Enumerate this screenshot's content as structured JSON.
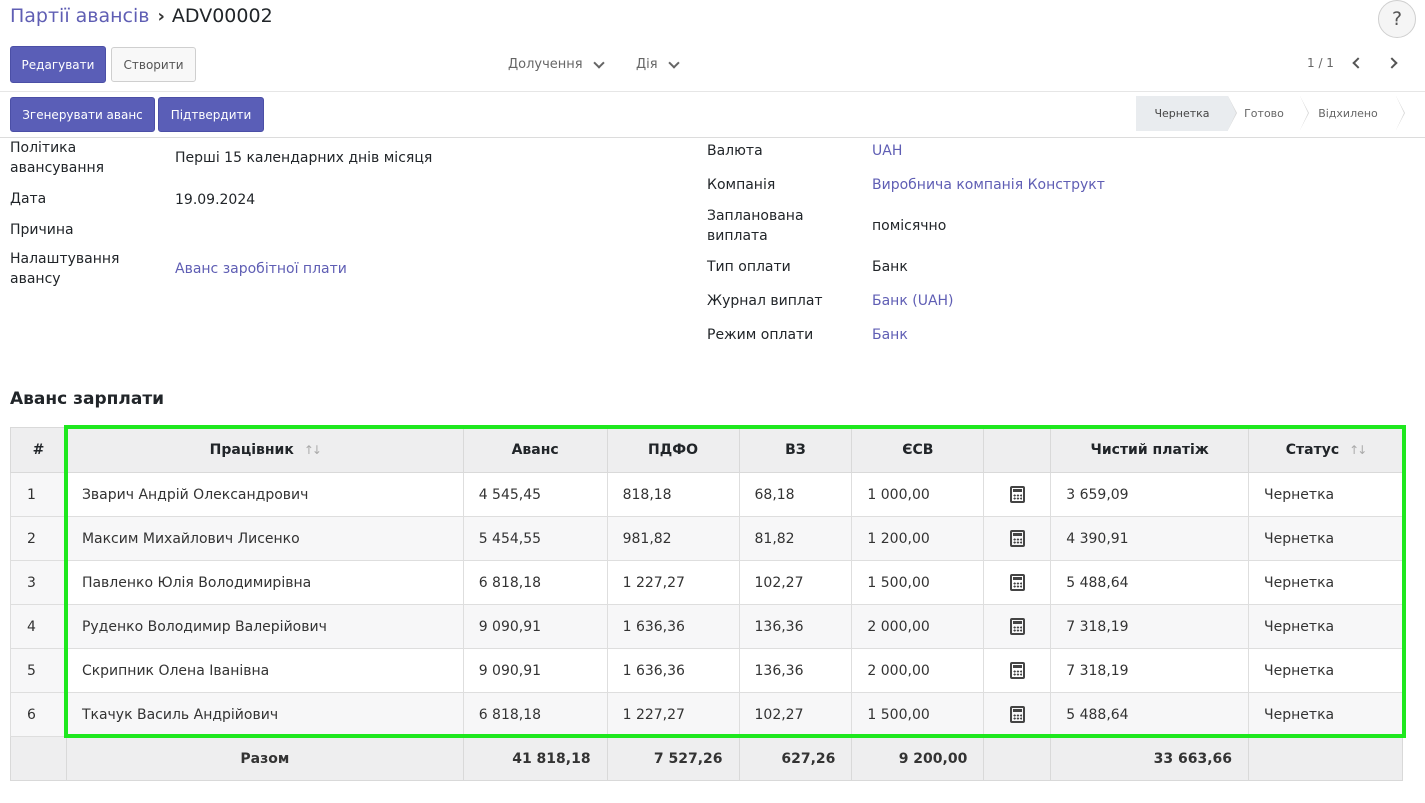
{
  "breadcrumb": {
    "parent": "Партії авансів",
    "separator": "›",
    "current": "ADV00002"
  },
  "help": {
    "label": "?"
  },
  "toolbar": {
    "edit": "Редагувати",
    "create": "Створити",
    "attach": "Долучення",
    "action": "Дія",
    "pager": "1 / 1"
  },
  "actions": {
    "generate": "Згенерувати аванс",
    "confirm": "Підтвердити"
  },
  "stages": [
    "Чернетка",
    "Готово",
    "Відхилено"
  ],
  "form_left": [
    {
      "label": "Політика авансування",
      "value": "Перші 15 календарних днів місяця",
      "link": false
    },
    {
      "label": "Дата",
      "value": "19.09.2024",
      "link": false
    },
    {
      "label": "Причина",
      "value": "",
      "link": false
    },
    {
      "label": "Налаштування авансу",
      "value": "Аванс заробітної плати",
      "link": true
    }
  ],
  "form_right": [
    {
      "label": "Валюта",
      "value": "UAH",
      "link": true
    },
    {
      "label": "Компанія",
      "value": "Виробнича компанія Конструкт",
      "link": true
    },
    {
      "label": "Запланована виплата",
      "value": "помісячно",
      "link": false
    },
    {
      "label": "Тип оплати",
      "value": "Банк",
      "link": false
    },
    {
      "label": "Журнал виплат",
      "value": "Банк (UAH)",
      "link": true
    },
    {
      "label": "Режим оплати",
      "value": "Банк",
      "link": true
    }
  ],
  "section_title": "Аванс зарплати",
  "table": {
    "headers": {
      "num": "#",
      "employee": "Працівник",
      "advance": "Аванс",
      "pdfo": "ПДФО",
      "vz": "ВЗ",
      "esv": "ЄСВ",
      "calc": "",
      "net": "Чистий платіж",
      "status": "Статус"
    },
    "sort_icon": "↑↓",
    "rows": [
      {
        "n": "1",
        "employee": "Зварич Андрій Олександрович",
        "advance": "4 545,45",
        "pdfo": "818,18",
        "vz": "68,18",
        "esv": "1 000,00",
        "net": "3 659,09",
        "status": "Чернетка"
      },
      {
        "n": "2",
        "employee": "Максим Михайлович Лисенко",
        "advance": "5 454,55",
        "pdfo": "981,82",
        "vz": "81,82",
        "esv": "1 200,00",
        "net": "4 390,91",
        "status": "Чернетка"
      },
      {
        "n": "3",
        "employee": "Павленко Юлія Володимирівна",
        "advance": "6 818,18",
        "pdfo": "1 227,27",
        "vz": "102,27",
        "esv": "1 500,00",
        "net": "5 488,64",
        "status": "Чернетка"
      },
      {
        "n": "4",
        "employee": "Руденко Володимир Валерійович",
        "advance": "9 090,91",
        "pdfo": "1 636,36",
        "vz": "136,36",
        "esv": "2 000,00",
        "net": "7 318,19",
        "status": "Чернетка"
      },
      {
        "n": "5",
        "employee": "Скрипник Олена Іванівна",
        "advance": "9 090,91",
        "pdfo": "1 636,36",
        "vz": "136,36",
        "esv": "2 000,00",
        "net": "7 318,19",
        "status": "Чернетка"
      },
      {
        "n": "6",
        "employee": "Ткачук Василь Андрійович",
        "advance": "6 818,18",
        "pdfo": "1 227,27",
        "vz": "102,27",
        "esv": "1 500,00",
        "net": "5 488,64",
        "status": "Чернетка"
      }
    ],
    "totals": {
      "label": "Разом",
      "advance": "41 818,18",
      "pdfo": "7 527,26",
      "vz": "627,26",
      "esv": "9 200,00",
      "net": "33 663,66"
    }
  },
  "colors": {
    "primary": "#5a5eb7",
    "link": "#5f5eb4",
    "highlight": "#1ee81e"
  }
}
